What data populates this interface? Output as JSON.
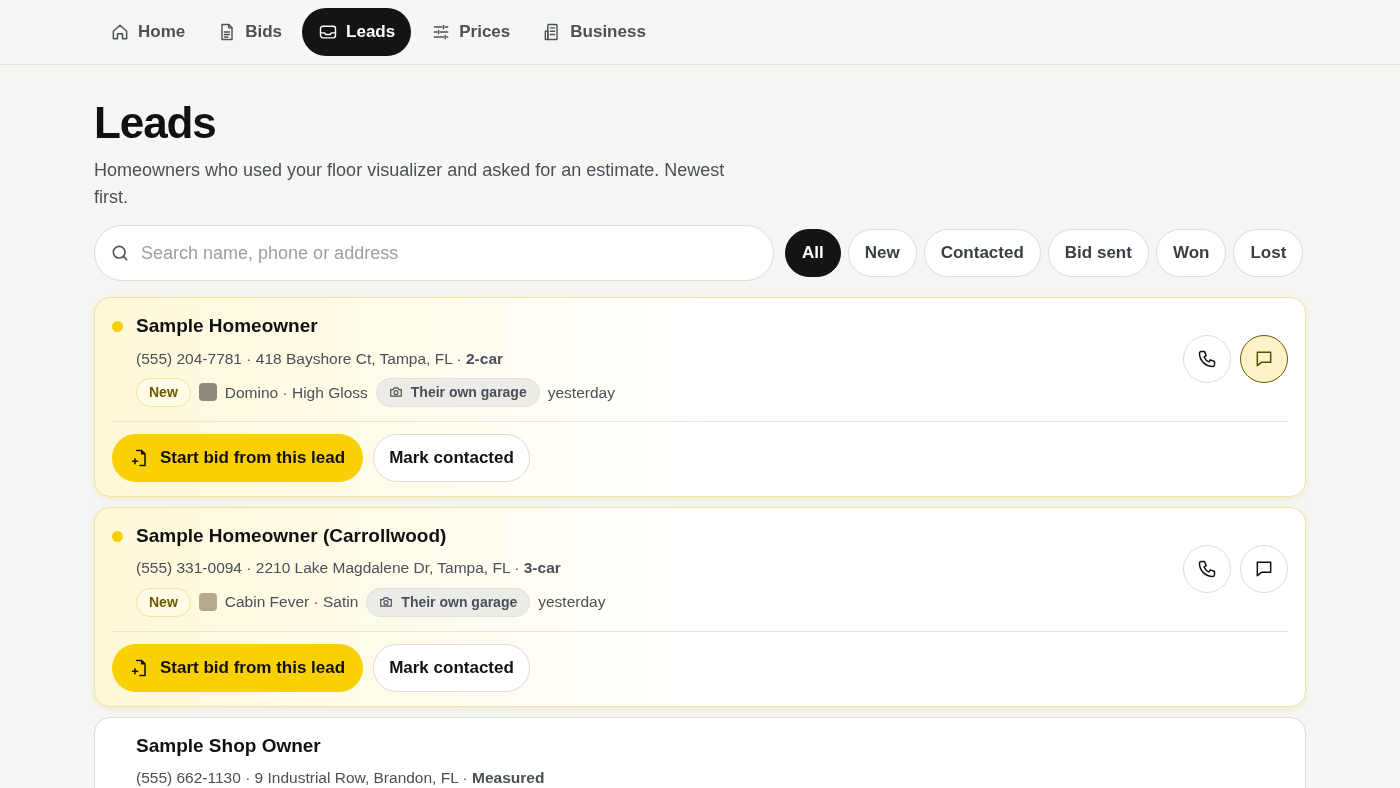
{
  "nav": [
    {
      "label": "Home",
      "selected": false
    },
    {
      "label": "Bids",
      "selected": false
    },
    {
      "label": "Leads",
      "selected": true
    },
    {
      "label": "Prices",
      "selected": false
    },
    {
      "label": "Business",
      "selected": false
    }
  ],
  "title": "Leads",
  "subtitle": "Homeowners who used your floor visualizer and asked for an estimate. Newest first.",
  "search": {
    "placeholder": "Search name, phone or address"
  },
  "filters": [
    {
      "label": "All",
      "selected": true
    },
    {
      "label": "New",
      "selected": false
    },
    {
      "label": "Contacted",
      "selected": false
    },
    {
      "label": "Bid sent",
      "selected": false
    },
    {
      "label": "Won",
      "selected": false
    },
    {
      "label": "Lost",
      "selected": false
    }
  ],
  "leads": [
    {
      "name": "Sample Homeowner",
      "unread": true,
      "highlighted": true,
      "info": "(555) 204-7781 · 418 Bayshore Ct, Tampa, FL · **2-car**",
      "status": "New",
      "swatch": {
        "color": "#8f8a78",
        "label": "Domino · High Gloss"
      },
      "source": "Their own garage",
      "time": "yesterday",
      "message_active": true,
      "actions": [
        "Start bid from this lead",
        "Mark contacted"
      ]
    },
    {
      "name": "Sample Homeowner (Carrollwood)",
      "unread": true,
      "highlighted": true,
      "info": "(555) 331-0094 · 2210 Lake Magdalene Dr, Tampa, FL · **3-car**",
      "status": "New",
      "swatch": {
        "color": "#b5aa8e",
        "label": "Cabin Fever · Satin"
      },
      "source": "Their own garage",
      "time": "yesterday",
      "message_active": false,
      "actions": [
        "Start bid from this lead",
        "Mark contacted"
      ]
    },
    {
      "name": "Sample Shop Owner",
      "unread": false,
      "highlighted": false,
      "info": "(555) 662-1130 · 9 Industrial Row, Brandon, FL · **Measured**"
    }
  ]
}
